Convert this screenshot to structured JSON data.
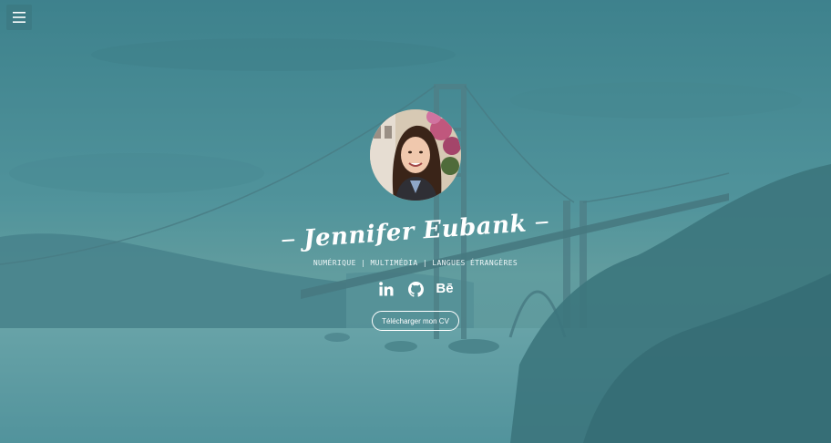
{
  "menu": {
    "icon": "hamburger-menu-icon"
  },
  "profile": {
    "name": "Jennifer Eubank",
    "tagline": "NUMÉRIQUE | MULTIMÉDIA | LANGUES ÉTRANGÈRES",
    "avatar_icon": "profile-photo"
  },
  "socials": [
    {
      "icon": "linkedin-icon"
    },
    {
      "icon": "github-icon"
    },
    {
      "icon": "behance-icon",
      "glyph": "Bē"
    }
  ],
  "cta": {
    "label": "Télécharger mon CV"
  },
  "colors": {
    "overlay": "#4a8b95",
    "text": "#ffffff"
  }
}
